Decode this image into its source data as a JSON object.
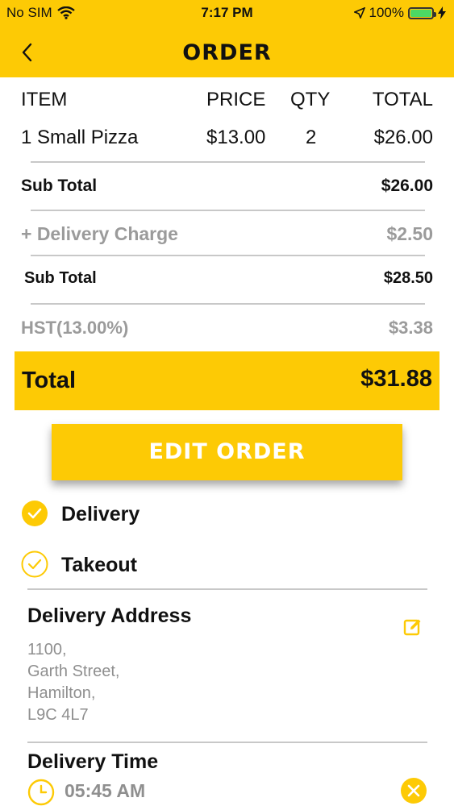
{
  "status_bar": {
    "carrier": "No SIM",
    "time": "7:17 PM",
    "battery": "100%"
  },
  "nav": {
    "title": "ORDER",
    "back_icon": "chevron-left-icon"
  },
  "table": {
    "headers": {
      "item": "ITEM",
      "price": "PRICE",
      "qty": "QTY",
      "total": "TOTAL"
    },
    "rows": [
      {
        "item": "1 Small Pizza",
        "price": "$13.00",
        "qty": "2",
        "total": "$26.00"
      }
    ]
  },
  "summary": {
    "subtotal_label": "Sub Total",
    "subtotal_value": "$26.00",
    "delivery_label": "+ Delivery Charge",
    "delivery_value": "$2.50",
    "subtotal2_label": "Sub Total",
    "subtotal2_value": "$28.50",
    "tax_label": "HST(13.00%)",
    "tax_value": "$3.38",
    "total_label": "Total",
    "total_value": "$31.88"
  },
  "edit_order_label": "EDIT ORDER",
  "options": [
    {
      "label": "Delivery",
      "selected": true
    },
    {
      "label": "Takeout",
      "selected": false
    }
  ],
  "address": {
    "title": "Delivery Address",
    "lines": [
      "1100,",
      "Garth Street,",
      "Hamilton,",
      "L9C 4L7"
    ]
  },
  "delivery_time": {
    "title": "Delivery Time",
    "value": "05:45 AM"
  },
  "colors": {
    "accent": "#fdca05",
    "grey_text": "#9b9b9b",
    "separator": "#c8c8c8"
  }
}
